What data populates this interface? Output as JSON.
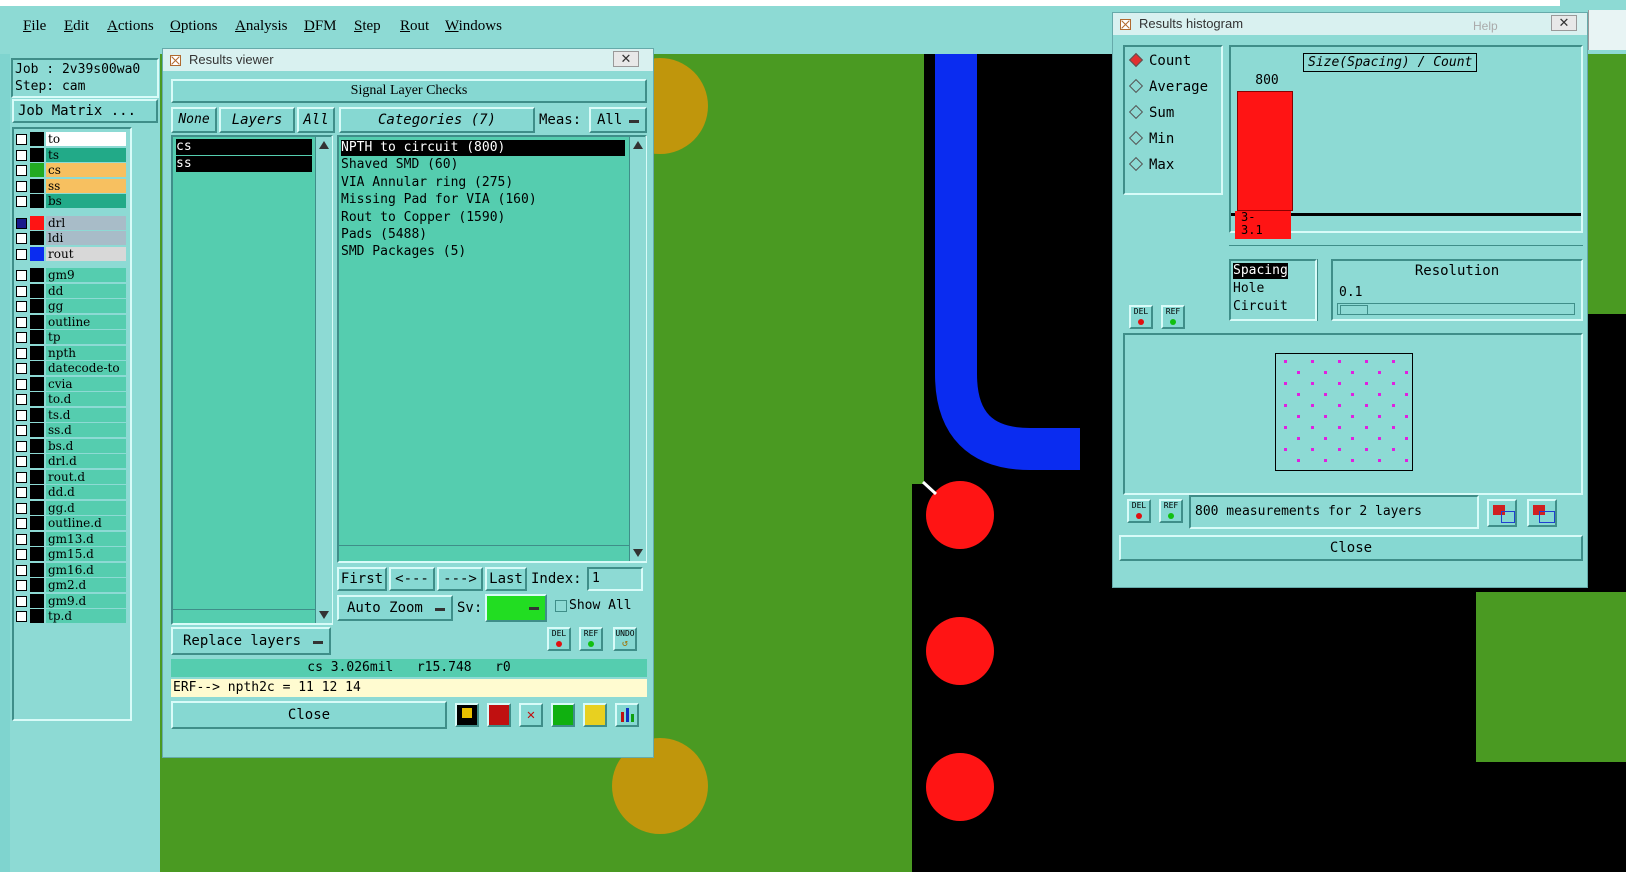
{
  "menu": [
    "File",
    "Edit",
    "Actions",
    "Options",
    "Analysis",
    "DFM",
    "Step",
    "Rout",
    "Windows"
  ],
  "job": {
    "job_label": "Job : 2v39s00wa0",
    "step_label": "Step: cam",
    "matrix_button": "Job Matrix ..."
  },
  "layers_group1": [
    {
      "name": "to",
      "color": "#ffffff"
    },
    {
      "name": "ts",
      "color": "#22aa88"
    },
    {
      "name": "cs",
      "color": "#f7c060"
    },
    {
      "name": "ss",
      "color": "#f7c060"
    },
    {
      "name": "bs",
      "color": "#22aa88"
    }
  ],
  "layers_group2": [
    {
      "name": "drl",
      "color": "#a8bcc8"
    },
    {
      "name": "ldi",
      "color": "#a8bcc8"
    },
    {
      "name": "rout",
      "color": "#d8d8d8"
    }
  ],
  "layers_group3": [
    "gm9",
    "dd",
    "gg",
    "outline",
    "tp",
    "npth",
    "datecode-to",
    "cvia",
    "to.d",
    "ts.d",
    "ss.d",
    "bs.d",
    "drl.d",
    "rout.d",
    "dd.d",
    "gg.d",
    "outline.d",
    "gm13.d",
    "gm15.d",
    "gm16.d",
    "gm2.d",
    "gm9.d",
    "tp.d"
  ],
  "results_viewer": {
    "title": "Results viewer",
    "header": "Signal Layer Checks",
    "none_btn": "None",
    "layers_btn": "Layers",
    "all_btn": "All",
    "categories_btn": "Categories (7)",
    "meas_label": "Meas:",
    "meas_value": "All",
    "layers": [
      "cs",
      "ss"
    ],
    "categories": [
      "NPTH to circuit (800)",
      "Shaved SMD (60)",
      "VIA Annular ring (275)",
      "Missing Pad for VIA (160)",
      "Rout to Copper (1590)",
      "Pads (5488)",
      "SMD Packages (5)"
    ],
    "nav": {
      "first": "First",
      "prev": "<---",
      "next": "--->",
      "last": "Last",
      "index_label": "Index:",
      "index_value": "1"
    },
    "auto_zoom": "Auto Zoom",
    "sv_label": "Sv:",
    "show_all": "Show All",
    "replace_layers": "Replace layers",
    "del": "DEL",
    "ref": "REF",
    "undo": "UNDO",
    "status": "cs 3.026mil   r15.748   r0",
    "erf": "ERF--> npth2c = 11 12 14",
    "close": "Close"
  },
  "histogram": {
    "title": "Results histogram",
    "modes": [
      "Count",
      "Average",
      "Sum",
      "Min",
      "Max"
    ],
    "selected_mode": "Count",
    "chart_title": "Size(Spacing) / Count",
    "bar_value": "800",
    "bar_label": "3-\n3.1",
    "types": [
      "Spacing",
      "Hole",
      "Circuit"
    ],
    "selected_type": "Spacing",
    "resolution_label": "Resolution",
    "resolution_value": "0.1",
    "measurements": "800 measurements for 2 layers",
    "del": "DEL",
    "ref": "REF",
    "close": "Close",
    "help": "Help"
  },
  "chart_data": {
    "type": "bar",
    "title": "Size(Spacing) / Count",
    "categories": [
      "3-3.1"
    ],
    "values": [
      800
    ]
  },
  "colors": {
    "board_green": "#4a9a22",
    "track_blue": "#0a2cf0",
    "pad_red": "#ff1414",
    "pad_gold": "#c0960c",
    "panel_teal": "#8ddad4",
    "list_teal": "#55cdaf"
  }
}
